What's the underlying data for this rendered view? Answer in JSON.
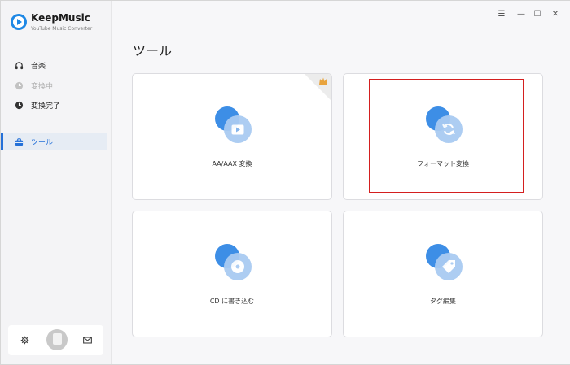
{
  "app": {
    "name": "KeepMusic",
    "subtitle": "YouTube Music Converter"
  },
  "sidebar": {
    "items": [
      {
        "label": "音楽",
        "icon": "headphones-icon",
        "state": "normal"
      },
      {
        "label": "変換中",
        "icon": "clock-icon",
        "state": "disabled"
      },
      {
        "label": "変換完了",
        "icon": "clock-icon",
        "state": "normal"
      },
      {
        "label": "ツール",
        "icon": "toolbox-icon",
        "state": "active"
      }
    ]
  },
  "bottom": {
    "settings_icon": "gear-icon",
    "avatar": "user-avatar",
    "mail_icon": "mail-icon"
  },
  "window_controls": {
    "menu": "☰",
    "minimize": "—",
    "maximize": "☐",
    "close": "✕"
  },
  "main": {
    "title": "ツール",
    "tools": [
      {
        "label": "AA/AAX 変換",
        "icon": "video-play-icon",
        "badge": "crown-icon"
      },
      {
        "label": "フォーマット変換",
        "icon": "convert-refresh-icon",
        "highlighted": true
      },
      {
        "label": "CD に書き込む",
        "icon": "disc-icon"
      },
      {
        "label": "タグ編集",
        "icon": "tag-icon"
      }
    ]
  },
  "colors": {
    "accent": "#2470d8",
    "icon_primary": "#3d8ee6",
    "icon_secondary": "#a9cbf2",
    "highlight": "#d41f1f"
  }
}
